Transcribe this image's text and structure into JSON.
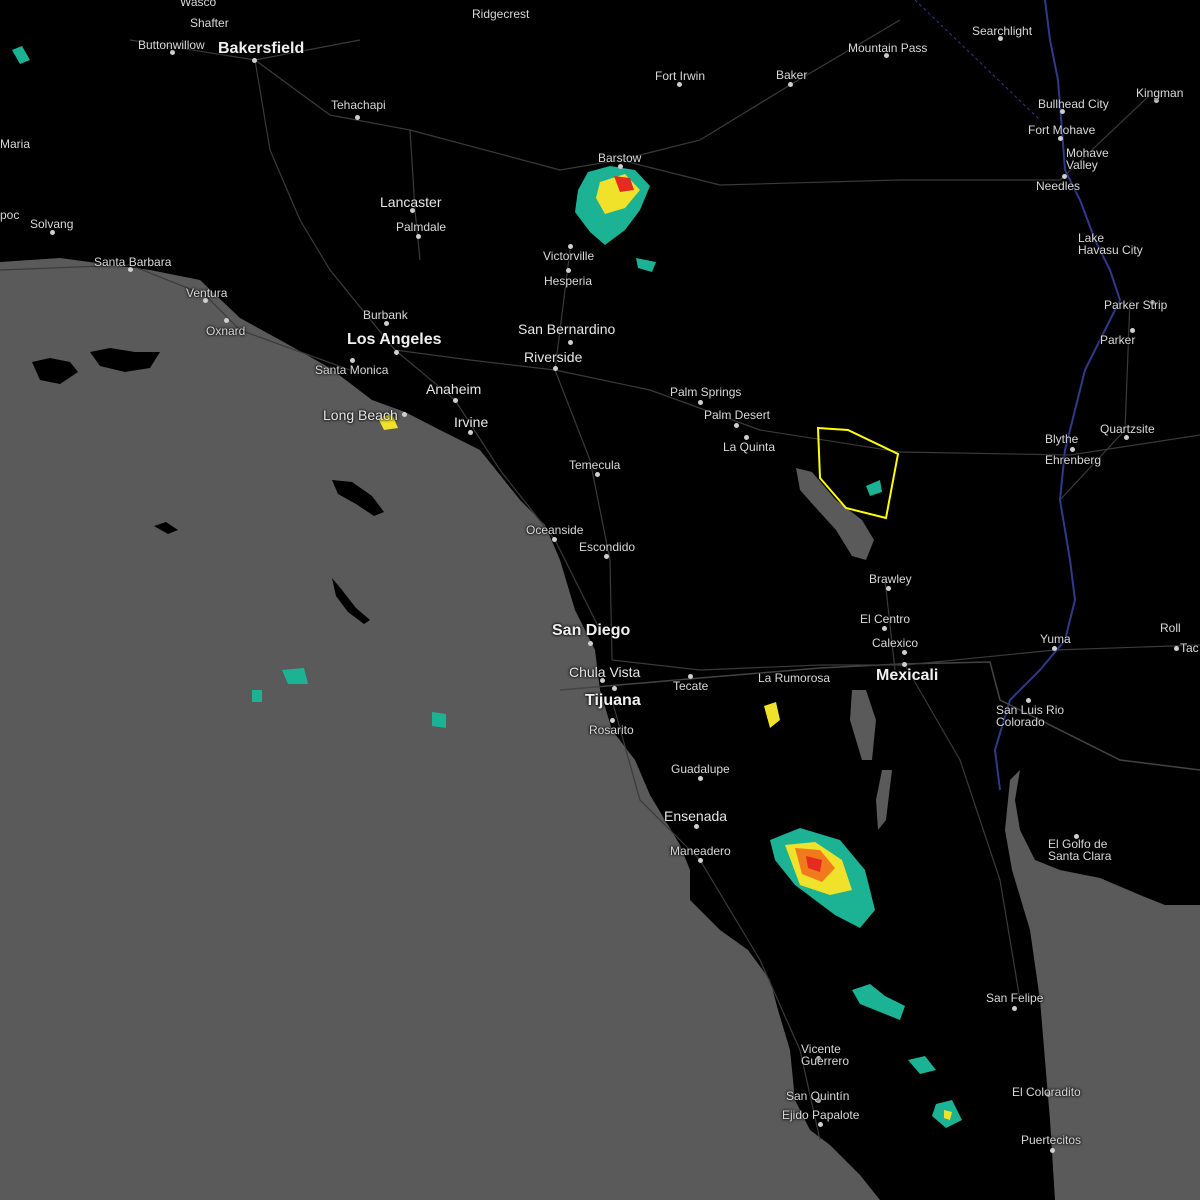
{
  "map": {
    "warning_color": "#ffff00",
    "ocean_color": "#5a5a5a",
    "land_color": "#000000",
    "road_color": "#3a3a3a"
  },
  "cities": [
    {
      "id": "wasco",
      "name": "Wasco"
    },
    {
      "id": "shafter",
      "name": "Shafter"
    },
    {
      "id": "buttonwillow",
      "name": "Buttonwillow"
    },
    {
      "id": "bakersfield",
      "name": "Bakersfield"
    },
    {
      "id": "ridgecrest",
      "name": "Ridgecrest"
    },
    {
      "id": "tehachapi",
      "name": "Tehachapi"
    },
    {
      "id": "fort-irwin",
      "name": "Fort Irwin"
    },
    {
      "id": "baker",
      "name": "Baker"
    },
    {
      "id": "mountain-pass",
      "name": "Mountain Pass"
    },
    {
      "id": "searchlight",
      "name": "Searchlight"
    },
    {
      "id": "bullhead-city",
      "name": "Bullhead City"
    },
    {
      "id": "kingman",
      "name": "Kingman"
    },
    {
      "id": "fort-mohave",
      "name": "Fort Mohave"
    },
    {
      "id": "mohave-valley",
      "name": "Mohave\nValley"
    },
    {
      "id": "needles",
      "name": "Needles"
    },
    {
      "id": "barstow",
      "name": "Barstow"
    },
    {
      "id": "lancaster",
      "name": "Lancaster"
    },
    {
      "id": "palmdale",
      "name": "Palmdale"
    },
    {
      "id": "maria",
      "name": "Maria"
    },
    {
      "id": "poc",
      "name": "poc"
    },
    {
      "id": "solvang",
      "name": "Solvang"
    },
    {
      "id": "santa-barbara",
      "name": "Santa Barbara"
    },
    {
      "id": "ventura",
      "name": "Ventura"
    },
    {
      "id": "oxnard",
      "name": "Oxnard"
    },
    {
      "id": "victorville",
      "name": "Victorville"
    },
    {
      "id": "hesperia",
      "name": "Hesperia"
    },
    {
      "id": "lake-havasu",
      "name": "Lake\nHavasu City"
    },
    {
      "id": "burbank",
      "name": "Burbank"
    },
    {
      "id": "los-angeles",
      "name": "Los Angeles"
    },
    {
      "id": "san-bernardino",
      "name": "San Bernardino"
    },
    {
      "id": "riverside",
      "name": "Riverside"
    },
    {
      "id": "parker-strip",
      "name": "Parker Strip"
    },
    {
      "id": "parker",
      "name": "Parker"
    },
    {
      "id": "santa-monica",
      "name": "Santa Monica"
    },
    {
      "id": "anaheim",
      "name": "Anaheim"
    },
    {
      "id": "palm-springs",
      "name": "Palm Springs"
    },
    {
      "id": "long-beach",
      "name": "Long Beach"
    },
    {
      "id": "irvine",
      "name": "Irvine"
    },
    {
      "id": "palm-desert",
      "name": "Palm Desert"
    },
    {
      "id": "la-quinta",
      "name": "La Quinta"
    },
    {
      "id": "quartzsite",
      "name": "Quartzsite"
    },
    {
      "id": "blythe",
      "name": "Blythe"
    },
    {
      "id": "ehrenberg",
      "name": "Ehrenberg"
    },
    {
      "id": "temecula",
      "name": "Temecula"
    },
    {
      "id": "oceanside",
      "name": "Oceanside"
    },
    {
      "id": "escondido",
      "name": "Escondido"
    },
    {
      "id": "brawley",
      "name": "Brawley"
    },
    {
      "id": "el-centro",
      "name": "El Centro"
    },
    {
      "id": "san-diego",
      "name": "San Diego"
    },
    {
      "id": "yuma",
      "name": "Yuma"
    },
    {
      "id": "roll",
      "name": "Roll"
    },
    {
      "id": "tac",
      "name": "Tac"
    },
    {
      "id": "calexico",
      "name": "Calexico"
    },
    {
      "id": "chula-vista",
      "name": "Chula Vista"
    },
    {
      "id": "mexicali",
      "name": "Mexicali"
    },
    {
      "id": "tecate",
      "name": "Tecate"
    },
    {
      "id": "la-rumorosa",
      "name": "La Rumorosa"
    },
    {
      "id": "tijuana",
      "name": "Tijuana"
    },
    {
      "id": "rosarito",
      "name": "Rosarito"
    },
    {
      "id": "san-luis-rio-colorado",
      "name": "San Luis Rio\nColorado"
    },
    {
      "id": "guadalupe",
      "name": "Guadalupe"
    },
    {
      "id": "ensenada",
      "name": "Ensenada"
    },
    {
      "id": "maneadero",
      "name": "Maneadero"
    },
    {
      "id": "el-golfo",
      "name": "El Golfo de\nSanta Clara"
    },
    {
      "id": "san-felipe",
      "name": "San Felipe"
    },
    {
      "id": "vicente-guerrero",
      "name": "Vicente\nGuerrero"
    },
    {
      "id": "san-quintin",
      "name": "San Quintín"
    },
    {
      "id": "ejido-papalote",
      "name": "Ejido Papalote"
    },
    {
      "id": "el-coloradito",
      "name": "El Coloradito"
    },
    {
      "id": "puertecitos",
      "name": "Puertecitos"
    }
  ]
}
